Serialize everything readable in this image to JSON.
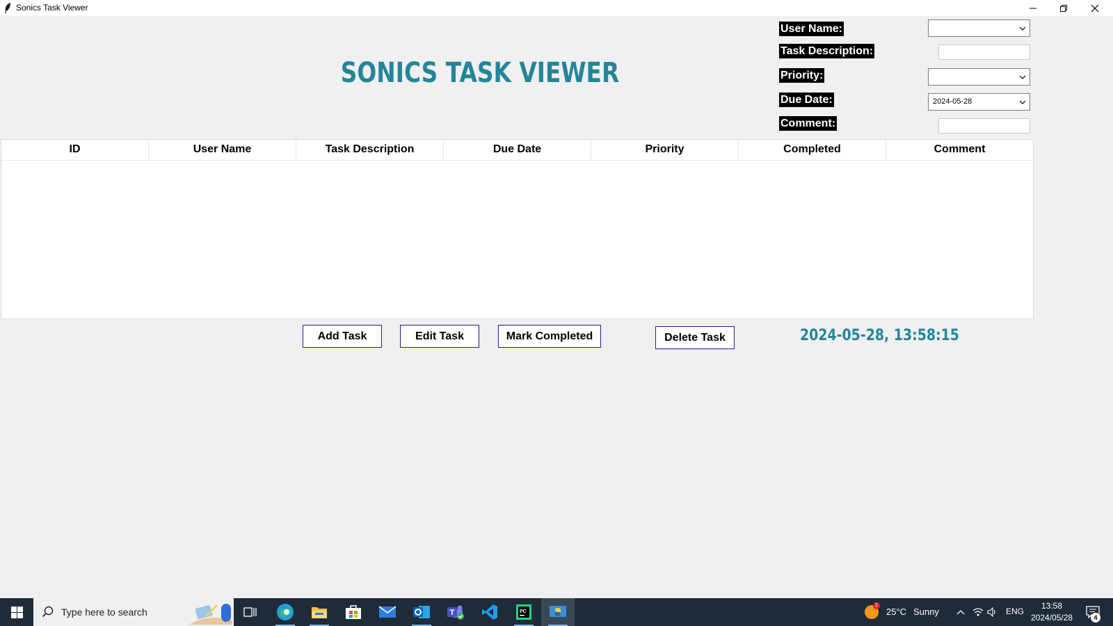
{
  "window": {
    "title": "Sonics Task Viewer"
  },
  "heading": "SONICS TASK VIEWER",
  "form": {
    "user_name_label": "User Name:",
    "user_name_value": "",
    "task_description_label": "Task Description:",
    "task_description_value": "",
    "priority_label": "Priority:",
    "priority_value": "",
    "due_date_label": "Due Date:",
    "due_date_value": "2024-05-28",
    "comment_label": "Comment:",
    "comment_value": ""
  },
  "table": {
    "columns": [
      "ID",
      "User Name",
      "Task Description",
      "Due Date",
      "Priority",
      "Completed",
      "Comment"
    ],
    "rows": []
  },
  "actions": {
    "add_label": "Add Task",
    "edit_label": "Edit Task",
    "complete_label": "Mark Completed",
    "delete_label": "Delete Task"
  },
  "clock": "2024-05-28, 13:58:15",
  "taskbar": {
    "search_placeholder": "Type here to search",
    "pinned": [
      "edge-icon",
      "file-explorer-icon",
      "store-icon",
      "mail-icon",
      "outlook-icon",
      "teams-icon",
      "vscode-icon",
      "pycharm-icon",
      "python-icon"
    ],
    "weather_temp": "25°C",
    "weather_desc": "Sunny",
    "weather_badge": "1",
    "language": "ENG",
    "time": "13:58",
    "date": "2024/05/28",
    "notification_count": "4"
  },
  "colors": {
    "accent": "#24859a",
    "taskbar": "#1f2b38",
    "button_border": "#1c1c9a"
  }
}
